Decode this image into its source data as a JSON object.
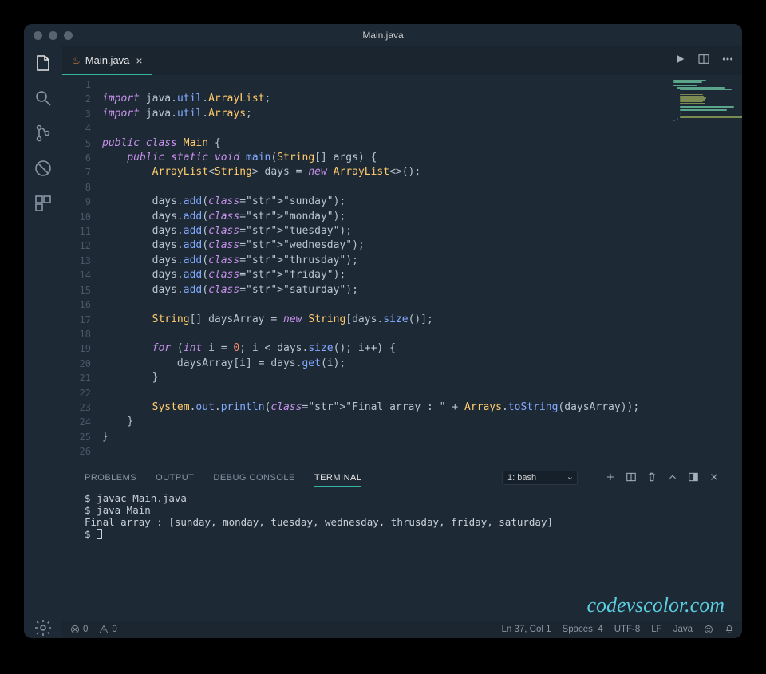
{
  "window": {
    "title": "Main.java"
  },
  "tab": {
    "filename": "Main.java"
  },
  "code_lines": [
    "",
    "import java.util.ArrayList;",
    "import java.util.Arrays;",
    "",
    "public class Main {",
    "    public static void main(String[] args) {",
    "        ArrayList<String> days = new ArrayList<>();",
    "",
    "        days.add(\"sunday\");",
    "        days.add(\"monday\");",
    "        days.add(\"tuesday\");",
    "        days.add(\"wednesday\");",
    "        days.add(\"thrusday\");",
    "        days.add(\"friday\");",
    "        days.add(\"saturday\");",
    "",
    "        String[] daysArray = new String[days.size()];",
    "",
    "        for (int i = 0; i < days.size(); i++) {",
    "            daysArray[i] = days.get(i);",
    "        }",
    "",
    "        System.out.println(\"Final array : \" + Arrays.toString(daysArray));",
    "    }",
    "}",
    ""
  ],
  "panel": {
    "tabs": {
      "problems": "PROBLEMS",
      "output": "OUTPUT",
      "debug": "DEBUG CONSOLE",
      "terminal": "TERMINAL"
    },
    "selector": "1: bash"
  },
  "terminal": {
    "line1": "$ javac Main.java",
    "line2": "$ java Main",
    "line3": "Final array : [sunday, monday, tuesday, wednesday, thrusday, friday, saturday]",
    "line4_prompt": "$ "
  },
  "watermark": "codevscolor.com",
  "statusbar": {
    "errors": "0",
    "warnings": "0",
    "cursor": "Ln 37, Col 1",
    "spaces": "Spaces: 4",
    "encoding": "UTF-8",
    "eol": "LF",
    "lang": "Java"
  }
}
